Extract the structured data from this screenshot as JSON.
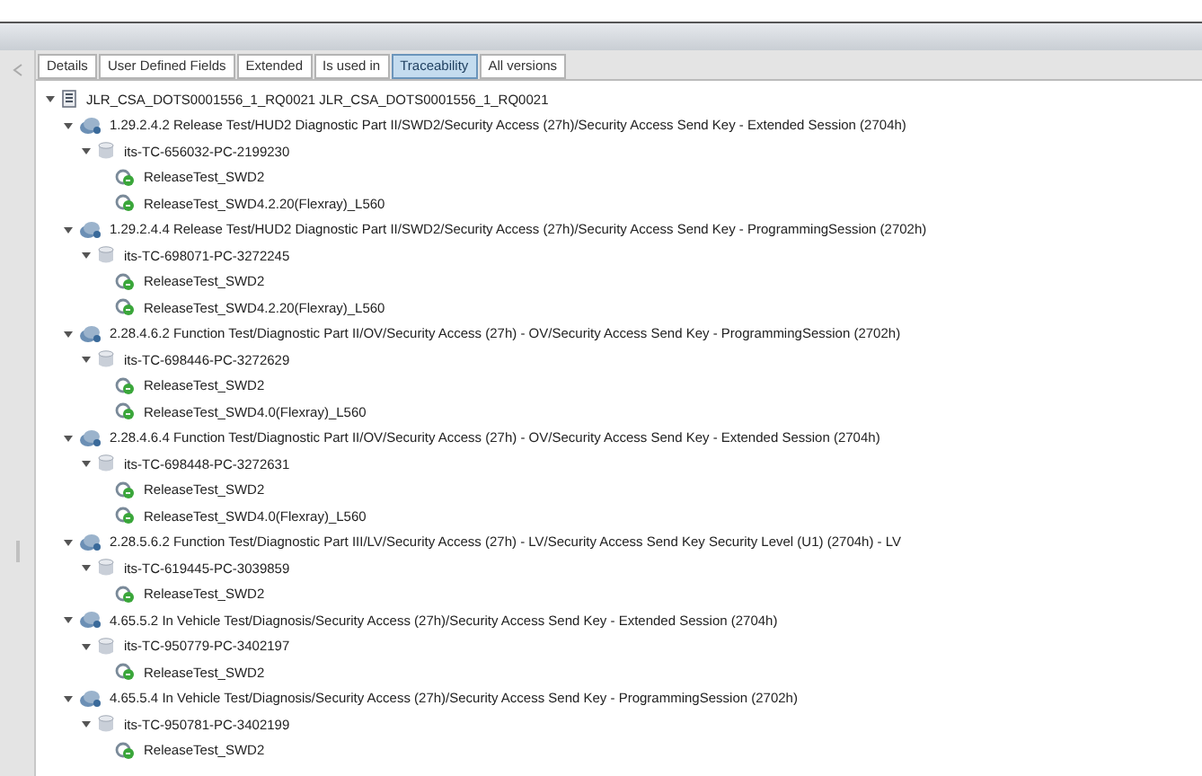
{
  "tabs": [
    {
      "label": "Details",
      "selected": false
    },
    {
      "label": "User Defined Fields",
      "selected": false
    },
    {
      "label": "Extended",
      "selected": false
    },
    {
      "label": "Is used in",
      "selected": false
    },
    {
      "label": "Traceability",
      "selected": true
    },
    {
      "label": "All versions",
      "selected": false
    }
  ],
  "tree": [
    {
      "kind": "document",
      "label": "JLR_CSA_DOTS0001556_1_RQ0021 JLR_CSA_DOTS0001556_1_RQ0021",
      "expanded": true,
      "children": [
        {
          "kind": "requirement",
          "label": "1.29.2.4.2 Release Test/HUD2 Diagnostic Part II/SWD2/Security Access (27h)/Security Access Send Key - Extended Session (2704h)",
          "expanded": true,
          "children": [
            {
              "kind": "test-case",
              "label": "its-TC-656032-PC-2199230",
              "expanded": true,
              "children": [
                {
                  "kind": "release-test",
                  "label": "ReleaseTest_SWD2"
                },
                {
                  "kind": "release-test",
                  "label": "ReleaseTest_SWD4.2.20(Flexray)_L560"
                }
              ]
            }
          ]
        },
        {
          "kind": "requirement",
          "label": "1.29.2.4.4 Release Test/HUD2 Diagnostic Part II/SWD2/Security Access (27h)/Security Access Send Key - ProgrammingSession (2702h)",
          "expanded": true,
          "children": [
            {
              "kind": "test-case",
              "label": "its-TC-698071-PC-3272245",
              "expanded": true,
              "children": [
                {
                  "kind": "release-test",
                  "label": "ReleaseTest_SWD2"
                },
                {
                  "kind": "release-test",
                  "label": "ReleaseTest_SWD4.2.20(Flexray)_L560"
                }
              ]
            }
          ]
        },
        {
          "kind": "requirement",
          "label": "2.28.4.6.2 Function Test/Diagnostic Part II/OV/Security Access (27h) - OV/Security Access Send Key - ProgrammingSession (2702h)",
          "expanded": true,
          "children": [
            {
              "kind": "test-case",
              "label": "its-TC-698446-PC-3272629",
              "expanded": true,
              "children": [
                {
                  "kind": "release-test",
                  "label": "ReleaseTest_SWD2"
                },
                {
                  "kind": "release-test",
                  "label": "ReleaseTest_SWD4.0(Flexray)_L560"
                }
              ]
            }
          ]
        },
        {
          "kind": "requirement",
          "label": "2.28.4.6.4 Function Test/Diagnostic Part II/OV/Security Access (27h) - OV/Security Access Send Key - Extended Session (2704h)",
          "expanded": true,
          "children": [
            {
              "kind": "test-case",
              "label": "its-TC-698448-PC-3272631",
              "expanded": true,
              "children": [
                {
                  "kind": "release-test",
                  "label": "ReleaseTest_SWD2"
                },
                {
                  "kind": "release-test",
                  "label": "ReleaseTest_SWD4.0(Flexray)_L560"
                }
              ]
            }
          ]
        },
        {
          "kind": "requirement",
          "label": "2.28.5.6.2 Function Test/Diagnostic Part III/LV/Security Access (27h) - LV/Security Access Send Key Security Level (U1) (2704h) - LV",
          "expanded": true,
          "children": [
            {
              "kind": "test-case",
              "label": "its-TC-619445-PC-3039859",
              "expanded": true,
              "children": [
                {
                  "kind": "release-test",
                  "label": "ReleaseTest_SWD2"
                }
              ]
            }
          ]
        },
        {
          "kind": "requirement",
          "label": "4.65.5.2 In Vehicle Test/Diagnosis/Security Access (27h)/Security Access Send Key - Extended Session (2704h)",
          "expanded": true,
          "children": [
            {
              "kind": "test-case",
              "label": "its-TC-950779-PC-3402197",
              "expanded": true,
              "children": [
                {
                  "kind": "release-test",
                  "label": "ReleaseTest_SWD2"
                }
              ]
            }
          ]
        },
        {
          "kind": "requirement",
          "label": "4.65.5.4 In Vehicle Test/Diagnosis/Security Access (27h)/Security Access Send Key - ProgrammingSession (2702h)",
          "expanded": true,
          "children": [
            {
              "kind": "test-case",
              "label": "its-TC-950781-PC-3402199",
              "expanded": true,
              "children": [
                {
                  "kind": "release-test",
                  "label": "ReleaseTest_SWD2"
                }
              ]
            }
          ]
        }
      ]
    }
  ]
}
